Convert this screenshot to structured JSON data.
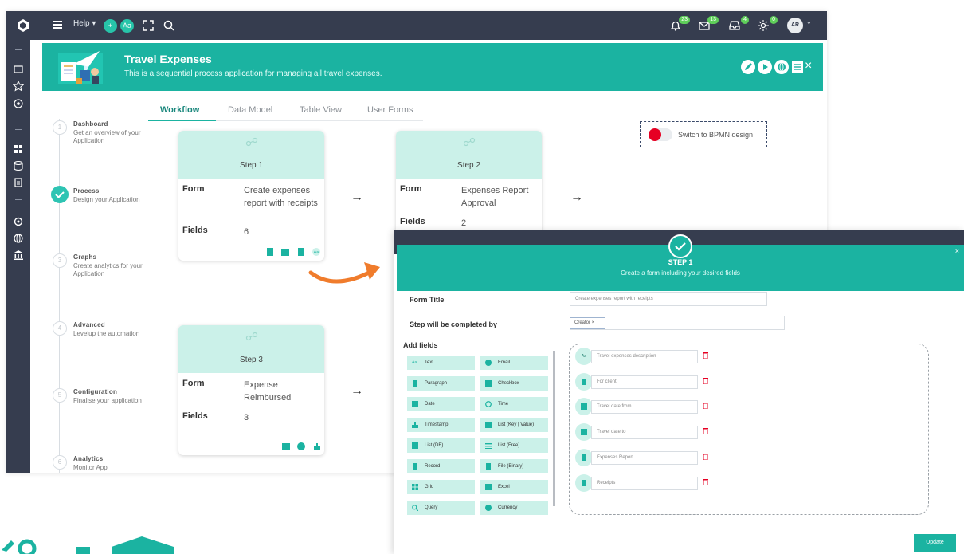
{
  "topbar": {
    "help_label": "Help ▾",
    "avatar_initials": "AR",
    "avatar_menu": "⌄",
    "notifications": [
      {
        "name": "bell",
        "count": "23"
      },
      {
        "name": "mail",
        "count": "13"
      },
      {
        "name": "inbox",
        "count": "4"
      },
      {
        "name": "activity",
        "count": "0"
      }
    ]
  },
  "banner": {
    "title": "Travel Expenses",
    "subtitle": "This is a sequential process application for managing all travel expenses.",
    "close": "×"
  },
  "steps": [
    {
      "num": "1",
      "title": "Dashboard",
      "desc": "Get an overview of your Application"
    },
    {
      "num": "2",
      "title": "Process",
      "desc": "Design your Application"
    },
    {
      "num": "3",
      "title": "Graphs",
      "desc": "Create analytics for your Application"
    },
    {
      "num": "4",
      "title": "Advanced",
      "desc": "Levelup the automation"
    },
    {
      "num": "5",
      "title": "Configuration",
      "desc": "Finalise your application"
    },
    {
      "num": "6",
      "title": "Analytics",
      "desc": "Monitor App performance"
    }
  ],
  "tabs": [
    "Workflow",
    "Data Model",
    "Table View",
    "User Forms"
  ],
  "bpmn": {
    "label": "Switch to BPMN design"
  },
  "cards": [
    {
      "step": "Step 1",
      "form_label": "Form",
      "form": "Create expenses report with receipts",
      "fields_label": "Fields",
      "fields": "6"
    },
    {
      "step": "Step 2",
      "form_label": "Form",
      "form": "Expenses Report Approval",
      "fields_label": "Fields",
      "fields": "2"
    },
    {
      "step": "Step 3",
      "form_label": "Form",
      "form": "Expense Reimbursed",
      "fields_label": "Fields",
      "fields": "3"
    }
  ],
  "arrow": "→",
  "modal": {
    "title": "STEP 1",
    "subtitle": "Create a form including your desired fields",
    "close": "×",
    "form_title_label": "Form Title",
    "form_title_value": "Create expenses report with receipts",
    "completed_by_label": "Step will be completed by",
    "completed_by_value": "Creator ×",
    "add_fields_label": "Add fields",
    "field_types": [
      [
        "Text",
        "Email"
      ],
      [
        "Paragraph",
        "Checkbox"
      ],
      [
        "Date",
        "Time"
      ],
      [
        "Timestamp",
        "List (Key | Value)"
      ],
      [
        "List (DB)",
        "List (Free)"
      ],
      [
        "Record",
        "File (Binary)"
      ],
      [
        "Grid",
        "Excel"
      ],
      [
        "Query",
        "Currency"
      ]
    ],
    "added_fields": [
      {
        "icon": "Aa",
        "value": "Travel expenses description"
      },
      {
        "icon": "",
        "value": "For client"
      },
      {
        "icon": "",
        "value": "Travel date from"
      },
      {
        "icon": "",
        "value": "Travel date to"
      },
      {
        "icon": "",
        "value": "Expenses Report"
      },
      {
        "icon": "",
        "value": "Receipts"
      }
    ],
    "update_label": "Update"
  },
  "colors": {
    "accent": "#1bb3a1",
    "dark": "#363d4f",
    "mint": "#cbf1e9",
    "orange": "#f07c2c",
    "danger": "#e60023"
  }
}
